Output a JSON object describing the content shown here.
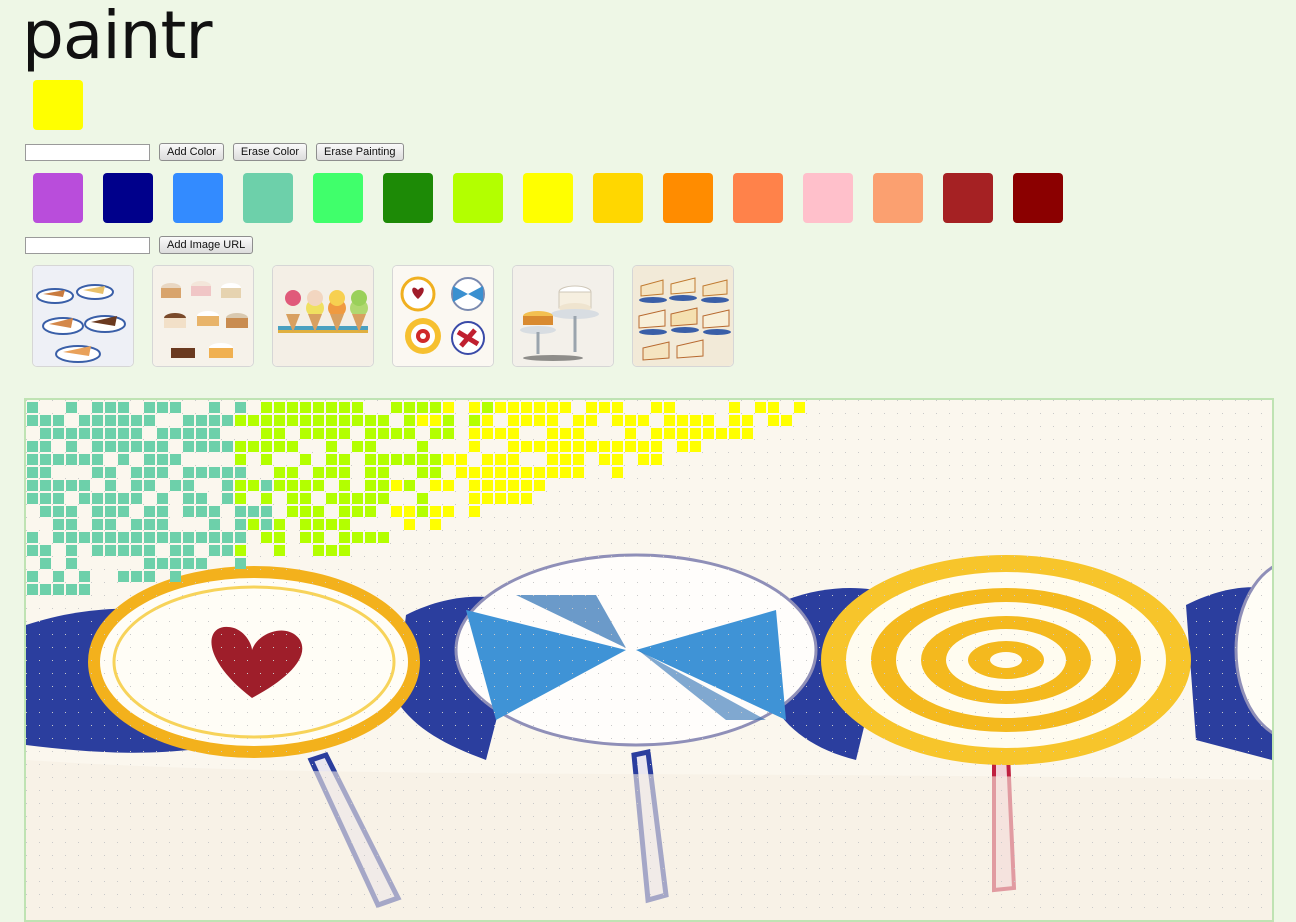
{
  "app": {
    "title": "paintr"
  },
  "current_color": "#ffff00",
  "color_controls": {
    "input_value": "",
    "add_label": "Add Color",
    "erase_label": "Erase Color",
    "erase_painting_label": "Erase Painting"
  },
  "palette": [
    {
      "name": "purple",
      "hex": "#b94ddb"
    },
    {
      "name": "navy",
      "hex": "#00008b"
    },
    {
      "name": "blue",
      "hex": "#338bff"
    },
    {
      "name": "teal",
      "hex": "#6dd0aa"
    },
    {
      "name": "green",
      "hex": "#40ff6b"
    },
    {
      "name": "dark-green",
      "hex": "#1d8a06"
    },
    {
      "name": "lime",
      "hex": "#b3ff00"
    },
    {
      "name": "yellow",
      "hex": "#ffff00"
    },
    {
      "name": "gold",
      "hex": "#ffd700"
    },
    {
      "name": "orange",
      "hex": "#ff8c00"
    },
    {
      "name": "coral",
      "hex": "#ff824a"
    },
    {
      "name": "pink",
      "hex": "#ffc0cb"
    },
    {
      "name": "salmon",
      "hex": "#fba070"
    },
    {
      "name": "brown-red",
      "hex": "#a52123"
    },
    {
      "name": "dark-red",
      "hex": "#8b0000"
    }
  ],
  "image_controls": {
    "input_value": "",
    "add_label": "Add Image URL"
  },
  "gallery": [
    {
      "subject": "pie-slices"
    },
    {
      "subject": "cakes-rows"
    },
    {
      "subject": "ice-cream-cones"
    },
    {
      "subject": "lollipops"
    },
    {
      "subject": "cake-stand"
    },
    {
      "subject": "cake-slices"
    }
  ],
  "canvas": {
    "background_subject": "lollipops",
    "painted_colors": [
      "#6dd0aa",
      "#b3ff00",
      "#ffff00"
    ]
  }
}
